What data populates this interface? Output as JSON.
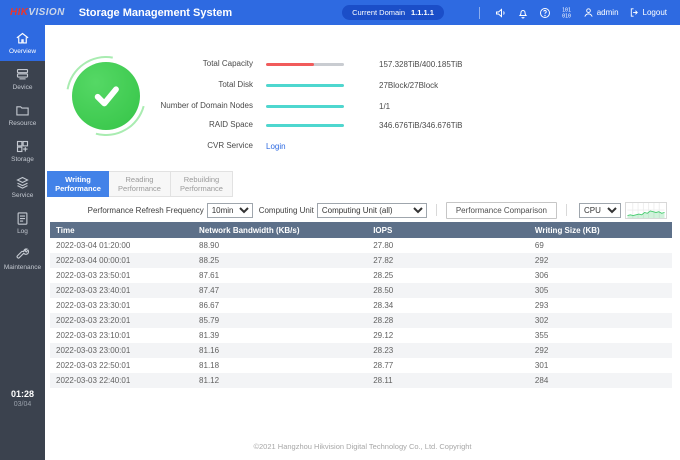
{
  "header": {
    "logo_hik": "HIK",
    "logo_vision": "VISION",
    "title": "Storage Management System",
    "domain_label": "Current Domain",
    "domain_value": "1.1.1.1",
    "admin_label": "admin",
    "logout_label": "Logout"
  },
  "sidebar": {
    "items": [
      {
        "label": "Overview",
        "active": true
      },
      {
        "label": "Device"
      },
      {
        "label": "Resource"
      },
      {
        "label": "Storage"
      },
      {
        "label": "Service"
      },
      {
        "label": "Log"
      },
      {
        "label": "Maintenance"
      }
    ],
    "clock_time": "01:28",
    "clock_date": "03/04"
  },
  "status": {
    "rows": [
      {
        "label": "Total Capacity",
        "value": "157.328TiB/400.185TiB"
      },
      {
        "label": "Total Disk",
        "value": "27Block/27Block"
      },
      {
        "label": "Number of Domain Nodes",
        "value": "1/1"
      },
      {
        "label": "RAID Space",
        "value": "346.676TiB/346.676TiB"
      }
    ],
    "cvr_label": "CVR Service",
    "cvr_link": "Login"
  },
  "tabs": [
    {
      "label": "Writing Performance",
      "active": true
    },
    {
      "label": "Reading Performance",
      "active": false
    },
    {
      "label": "Rebuilding Performance",
      "active": false
    }
  ],
  "controls": {
    "refresh_label": "Performance Refresh Frequency",
    "refresh_value": "10min",
    "unit_label": "Computing Unit",
    "unit_value": "Computing Unit (all)",
    "comparison_button": "Performance Comparison",
    "metric_value": "CPU",
    "sparkline": {
      "color": "#45cb6e",
      "points": [
        2,
        3,
        2,
        3,
        4,
        3,
        6,
        5,
        8,
        7,
        6,
        7,
        5,
        6
      ]
    }
  },
  "table": {
    "headers": [
      "Time",
      "Network Bandwidth (KB/s)",
      "IOPS",
      "Writing Size (KB)"
    ],
    "rows": [
      [
        "2022-03-04 01:20:00",
        "88.90",
        "27.80",
        "69"
      ],
      [
        "2022-03-04 00:00:01",
        "88.25",
        "27.82",
        "292"
      ],
      [
        "2022-03-03 23:50:01",
        "87.61",
        "28.25",
        "306"
      ],
      [
        "2022-03-03 23:40:01",
        "87.47",
        "28.50",
        "305"
      ],
      [
        "2022-03-03 23:30:01",
        "86.67",
        "28.34",
        "293"
      ],
      [
        "2022-03-03 23:20:01",
        "85.79",
        "28.28",
        "302"
      ],
      [
        "2022-03-03 23:10:01",
        "81.39",
        "29.12",
        "355"
      ],
      [
        "2022-03-03 23:00:01",
        "81.16",
        "28.23",
        "292"
      ],
      [
        "2022-03-03 22:50:01",
        "81.18",
        "28.77",
        "301"
      ],
      [
        "2022-03-03 22:40:01",
        "81.12",
        "28.11",
        "284"
      ]
    ]
  },
  "footer": {
    "copyright": "©2021 Hangzhou Hikvision Digital Technology Co., Ltd. Copyright"
  },
  "colors": {
    "header": "#2e6ae1",
    "sidebar": "#3b424e",
    "accent": "#2e6ae1",
    "ok_green": "#3fcc4e",
    "bar_red": "#f15b5b",
    "bar_teal": "#4ed7cf",
    "table_header": "#5d7089"
  }
}
